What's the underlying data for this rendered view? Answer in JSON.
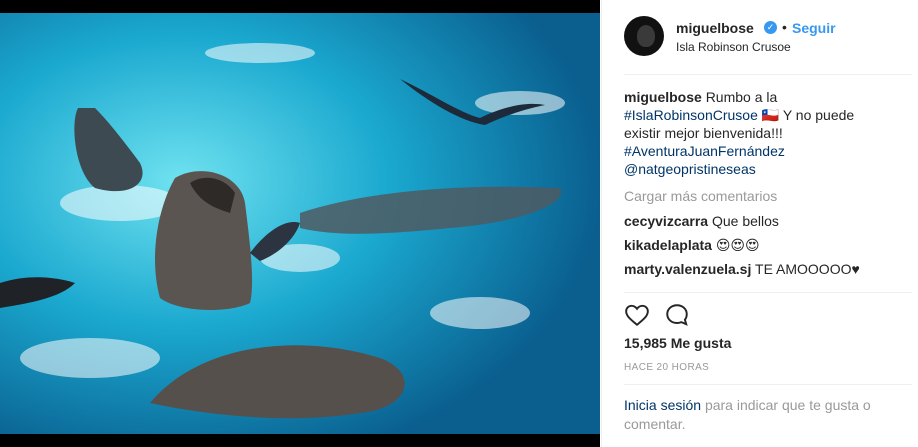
{
  "post": {
    "username": "miguelbose",
    "follow_label": "Seguir",
    "separator": "•",
    "location": "Isla Robinson Crusoe"
  },
  "caption": {
    "username": "miguelbose",
    "text_start": "Rumbo a la",
    "hashtag1": "#IslaRobinsonCrusoe",
    "text_middle": "🇨🇱 Y no puede existir mejor bienvenida!!!",
    "hashtag2": "#AventuraJuanFernández",
    "mention": "@natgeopristineseas"
  },
  "load_more": "Cargar más comentarios",
  "comments": [
    {
      "user": "cecyvizcarra",
      "text": "Que bellos"
    },
    {
      "user": "kikadelaplata",
      "text": "😍😍😍"
    },
    {
      "user": "marty.valenzuela.sj",
      "text": "TE AMOOOOO♥"
    },
    {
      "user": "...",
      "text": "..."
    }
  ],
  "likes": "15,985 Me gusta",
  "time_ago": "HACE 20 HORAS",
  "login_prompt": {
    "link": "Inicia sesión",
    "text": "para indicar que te gusta o comentar."
  },
  "icons": {
    "verified": "verified-badge-icon",
    "like": "heart-icon",
    "comment": "comment-bubble-icon"
  },
  "colors": {
    "accent": "#3897f0",
    "link": "#003569",
    "muted": "#999999"
  }
}
